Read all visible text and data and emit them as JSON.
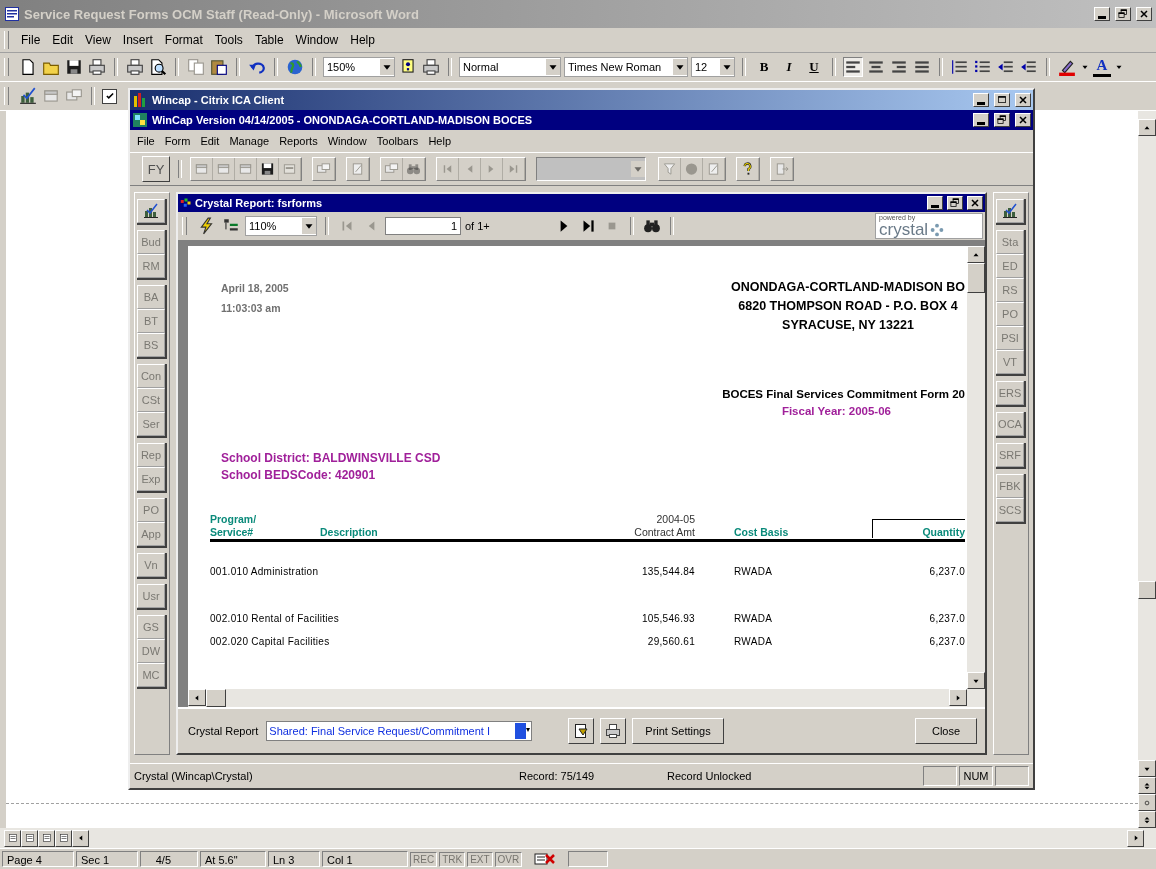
{
  "word": {
    "title": "Service Request Forms OCM Staff (Read-Only) - Microsoft Word",
    "menu": [
      "File",
      "Edit",
      "View",
      "Insert",
      "Format",
      "Tools",
      "Table",
      "Window",
      "Help"
    ],
    "toolbar": {
      "zoom": "150%",
      "style": "Normal",
      "font": "Times New Roman",
      "size": "12",
      "format_buttons": [
        "B",
        "I",
        "U"
      ],
      "font_color_label": "A"
    },
    "checkbox": {
      "checked": true
    },
    "status_bar": {
      "fields": [
        "Page 4",
        "Sec 1",
        "4/5",
        "At 5.6\"",
        "Ln 3",
        "Col 1"
      ],
      "modes": [
        {
          "label": "REC",
          "disabled": true
        },
        {
          "label": "TRK",
          "disabled": true
        },
        {
          "label": "EXT",
          "disabled": true
        },
        {
          "label": "OVR",
          "disabled": true
        }
      ]
    }
  },
  "citrix": {
    "title": "Wincap - Citrix ICA Client"
  },
  "wincap": {
    "title": "WinCap Version 04/14/2005 - ONONDAGA-CORTLAND-MADISON BOCES",
    "menu": [
      "File",
      "Form",
      "Edit",
      "Manage",
      "Reports",
      "Window",
      "Toolbars",
      "Help"
    ],
    "toolbar_label": "FY",
    "left_groups": [
      [
        "Bud",
        "RM"
      ],
      [
        "BA",
        "BT",
        "BS"
      ],
      [
        "Con",
        "CSt",
        "Ser"
      ],
      [
        "Rep",
        "Exp"
      ],
      [
        "PO",
        "App"
      ],
      [
        "Vn"
      ],
      [
        "Usr"
      ],
      [
        "GS",
        "DW",
        "MC"
      ]
    ],
    "right_groups": [
      [
        "Sta",
        "ED",
        "RS",
        "PO",
        "PSI",
        "VT"
      ],
      [
        "ERS"
      ],
      [
        "OCA"
      ],
      [
        "SRF"
      ],
      [
        "FBK",
        "SCS"
      ]
    ],
    "status": [
      "Crystal (Wincap\\Crystal)",
      "Record: 75/149",
      "Record Unlocked"
    ],
    "indicator": "NUM"
  },
  "crystal": {
    "title": "Crystal Report: fsrforms",
    "zoom": "110%",
    "page": "1",
    "page_of": "of 1+",
    "logo_small": "powered by",
    "logo": "crystal",
    "report": {
      "date": "April 18, 2005",
      "time": "11:03:03 am",
      "org": [
        "ONONDAGA-CORTLAND-MADISON BO",
        "6820 THOMPSON ROAD - P.O. BOX 4",
        "SYRACUSE, NY  13221"
      ],
      "form_title": "BOCES Final Services Commitment Form 20",
      "fiscal_year": "Fiscal Year: 2005-06",
      "district": [
        "School District: BALDWINSVILLE CSD",
        "School BEDSCode: 420901"
      ],
      "columns": [
        {
          "top": "Program/",
          "label": "Service#"
        },
        {
          "label": "Description"
        },
        {
          "top": "2004-05",
          "label": "Contract Amt"
        },
        {
          "label": "Cost Basis"
        },
        {
          "label": "Quantity"
        }
      ],
      "row_groups": [
        [
          {
            "service": "001.010 Administration",
            "amount": "135,544.84",
            "basis": "RWADA",
            "quantity": "6,237.0"
          }
        ],
        [
          {
            "service": "002.010 Rental of Facilities",
            "amount": "105,546.93",
            "basis": "RWADA",
            "quantity": "6,237.0"
          },
          {
            "service": "002.020 Capital Facilities",
            "amount": "29,560.61",
            "basis": "RWADA",
            "quantity": "6,237.0"
          }
        ]
      ]
    },
    "footer": {
      "label": "Crystal Report",
      "report_field": "Shared: Final Service Request/Commitment I",
      "print_button": "Print Settings",
      "close_button": "Close"
    }
  }
}
